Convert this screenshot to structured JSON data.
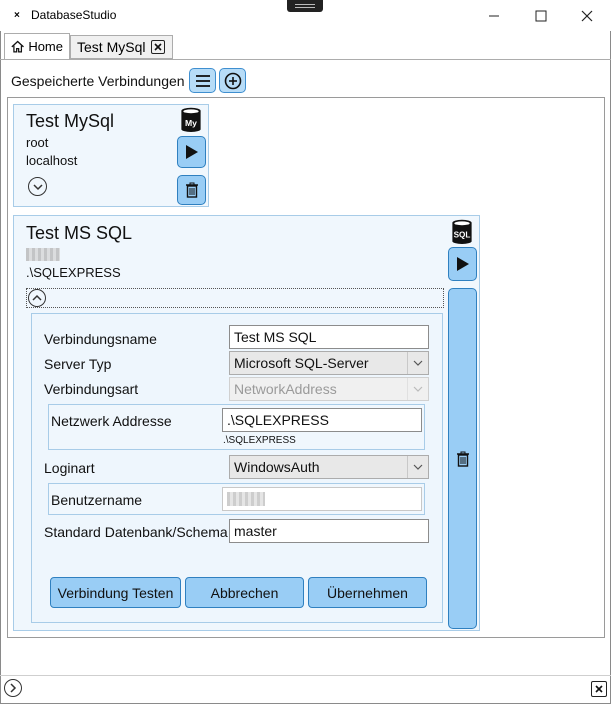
{
  "window": {
    "title": "DatabaseStudio",
    "icon_glyph": "×"
  },
  "tabs": [
    {
      "label": "Home",
      "icon": "home-icon"
    },
    {
      "label": "Test MySql",
      "icon": "close-icon"
    }
  ],
  "header": {
    "saved_connections_label": "Gespeicherte Verbindungen"
  },
  "connections": [
    {
      "title": "Test MySql",
      "user": "root",
      "host": "localhost",
      "db_badge": "My",
      "expanded": false
    },
    {
      "title": "Test MS SQL",
      "host": ".\\SQLEXPRESS",
      "db_badge": "SQL",
      "expanded": true
    }
  ],
  "form": {
    "connection_name_label": "Verbindungsname",
    "connection_name_value": "Test MS SQL",
    "server_type_label": "Server Typ",
    "server_type_value": "Microsoft SQL-Server",
    "connection_type_label": "Verbindungsart",
    "connection_type_value": "NetworkAddress",
    "network_address_label": "Netzwerk Addresse",
    "network_address_value": ".\\SQLEXPRESS",
    "network_address_hint": ".\\SQLEXPRESS",
    "login_type_label": "Loginart",
    "login_type_value": "WindowsAuth",
    "username_label": "Benutzername",
    "default_db_label": "Standard Datenbank/Schema",
    "default_db_value": "master",
    "test_button": "Verbindung Testen",
    "cancel_button": "Abbrechen",
    "apply_button": "Übernehmen"
  },
  "colors": {
    "accent": "#99cdf5",
    "accent_border": "#2f80c0",
    "card_bg": "#f0f7fd"
  }
}
